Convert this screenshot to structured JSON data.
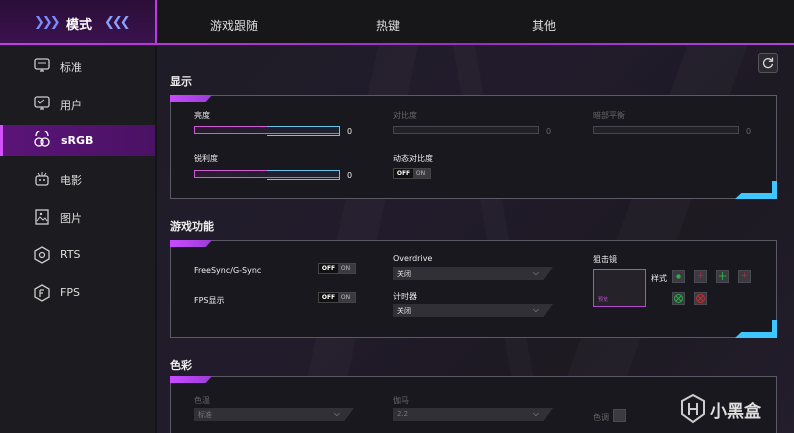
{
  "top_tabs": [
    {
      "label": "模式",
      "active": true
    },
    {
      "label": "游戏跟随"
    },
    {
      "label": "热键"
    },
    {
      "label": "其他"
    }
  ],
  "sidebar": {
    "items": [
      {
        "label": "标准",
        "icon": "monitor-icon"
      },
      {
        "label": "用户",
        "icon": "monitor-user-icon"
      },
      {
        "label": "sRGB",
        "icon": "srgb-icon",
        "active": true
      },
      {
        "label": "电影",
        "icon": "movie-icon"
      },
      {
        "label": "图片",
        "icon": "picture-icon"
      },
      {
        "label": "RTS",
        "icon": "rts-icon"
      },
      {
        "label": "FPS",
        "icon": "fps-icon"
      }
    ]
  },
  "display": {
    "title": "显示",
    "brightness": {
      "label": "亮度",
      "value": "0"
    },
    "contrast": {
      "label": "对比度",
      "value": "0"
    },
    "dark_balance": {
      "label": "暗部平衡",
      "value": "0"
    },
    "sharpness": {
      "label": "锐利度",
      "value": "0"
    },
    "dynamic_contrast": {
      "label": "动态对比度",
      "off": "OFF",
      "on": "ON"
    }
  },
  "game": {
    "title": "游戏功能",
    "freesync": {
      "label": "FreeSync/G-Sync",
      "off": "OFF",
      "on": "ON"
    },
    "fps_display": {
      "label": "FPS显示",
      "off": "OFF",
      "on": "ON"
    },
    "overdrive": {
      "label": "Overdrive",
      "value": "关闭"
    },
    "timer": {
      "label": "计时器",
      "value": "关闭"
    },
    "scope": {
      "label": "狙击镜",
      "style_label": "样式",
      "preview_text": "预览"
    }
  },
  "color": {
    "title": "色彩",
    "temp": {
      "label": "色温",
      "value": "标准"
    },
    "gamma": {
      "label": "伽马",
      "value": "2.2"
    },
    "hue": {
      "label": "色调"
    }
  },
  "watermark": {
    "text": "小黑盒"
  },
  "colors": {
    "accent": "#c23ce6",
    "cyan": "#3ec6ff",
    "green": "#2fa84a",
    "red": "#c03030"
  }
}
